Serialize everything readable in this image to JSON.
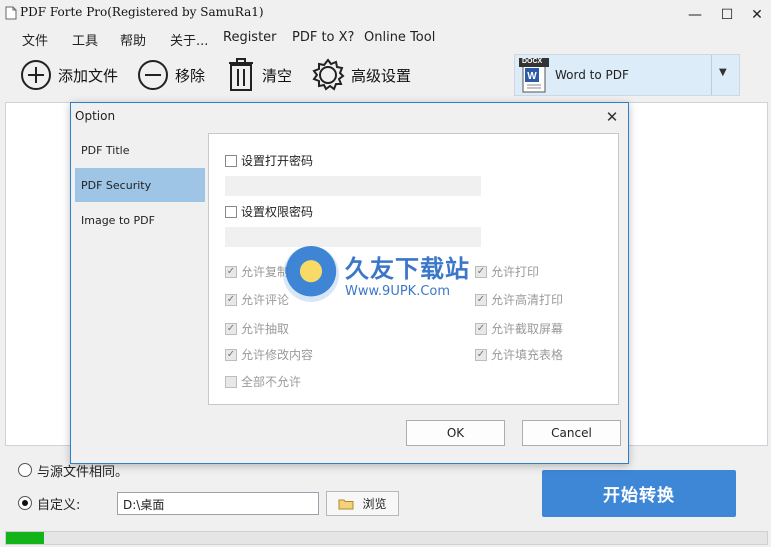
{
  "window": {
    "title": "PDF Forte Pro(Registered by SamuRa1)",
    "minimize": "—",
    "maximize": "☐",
    "close": "✕"
  },
  "menu": [
    "文件",
    "工具",
    "帮助",
    "关于...",
    "Register",
    "PDF to X?",
    "Online Tool"
  ],
  "toolbar": {
    "add": "添加文件",
    "remove": "移除",
    "clear": "清空",
    "advanced": "高级设置"
  },
  "format": {
    "icon_text": "DOCX",
    "selected": "Word to PDF"
  },
  "output": {
    "same_as_source": "与源文件相同。",
    "custom": "自定义:",
    "path": "D:\\桌面",
    "browse": "浏览",
    "selected": "custom"
  },
  "start_button": "开始转换",
  "progress": 0.05,
  "colors": {
    "accent": "#3e87d7",
    "progress": "#13b31a",
    "nav_active": "#9ec4e6"
  },
  "dialog": {
    "title": "Option",
    "nav": [
      "PDF Title",
      "PDF Security",
      "Image to PDF"
    ],
    "active_nav": "PDF Security",
    "open_password_label": "设置打开密码",
    "permission_password_label": "设置权限密码",
    "permissions_left": [
      "允许复制",
      "允许评论",
      "允许抽取",
      "允许修改内容",
      "全部不允许"
    ],
    "permissions_right": [
      "允许打印",
      "允许高清打印",
      "允许截取屏幕",
      "允许填充表格"
    ],
    "ok": "OK",
    "cancel": "Cancel"
  },
  "watermark": {
    "brand": "久友下载站",
    "url": "Www.9UPK.Com"
  }
}
